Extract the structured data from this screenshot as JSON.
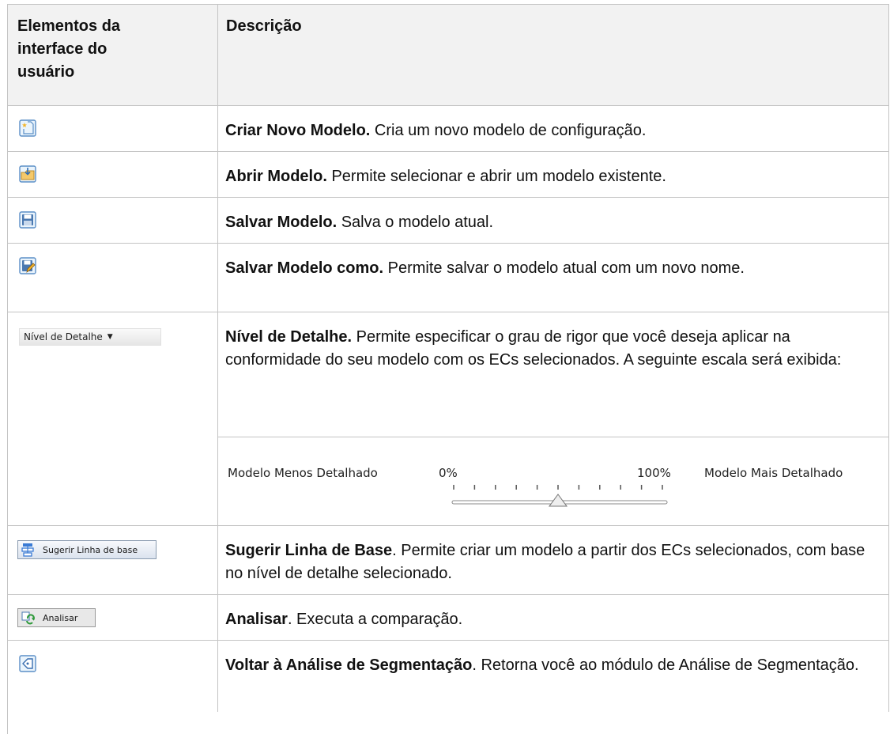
{
  "header": {
    "col1_lines": [
      "Elementos da",
      "interface do",
      "usuário"
    ],
    "col2": "Descrição"
  },
  "rows": [
    {
      "icon": "new-template-icon",
      "title": "Criar Novo Modelo.",
      "text": " Cria um novo modelo de configuração."
    },
    {
      "icon": "open-template-icon",
      "title": "Abrir Modelo.",
      "text": "  Permite selecionar e abrir um modelo existente."
    },
    {
      "icon": "save-icon",
      "title": "Salvar Modelo.",
      "text": " Salva o modelo atual."
    },
    {
      "icon": "save-as-icon",
      "title": "Salvar Modelo como.",
      "text": " Permite salvar o modelo atual com um novo nome."
    },
    {
      "widget_label": "Nível de Detalhe",
      "title": "Nível de Detalhe.",
      "text": "  Permite especificar o grau de rigor que você deseja aplicar na conformidade do seu modelo com os ECs selecionados. A seguinte escala será exibida:"
    },
    {
      "widget_label": "Sugerir Linha de base",
      "icon": "baseline-icon",
      "title": "Sugerir Linha de Base",
      "text": ". Permite criar um modelo a partir dos ECs selecionados, com base no nível de detalhe selecionado."
    },
    {
      "widget_label": "Analisar",
      "icon": "analyze-icon",
      "title": "Analisar",
      "text": ". Executa a comparação."
    },
    {
      "icon": "back-icon",
      "title": "Voltar à Análise de Segmentação",
      "text": ". Retorna você ao módulo de Análise de Segmentação."
    }
  ],
  "scale": {
    "left_label": "Modelo Menos Detalhado",
    "min": "0%",
    "max": "100%",
    "right_label": "Modelo Mais Detalhado",
    "level_fraction": 0.5
  }
}
